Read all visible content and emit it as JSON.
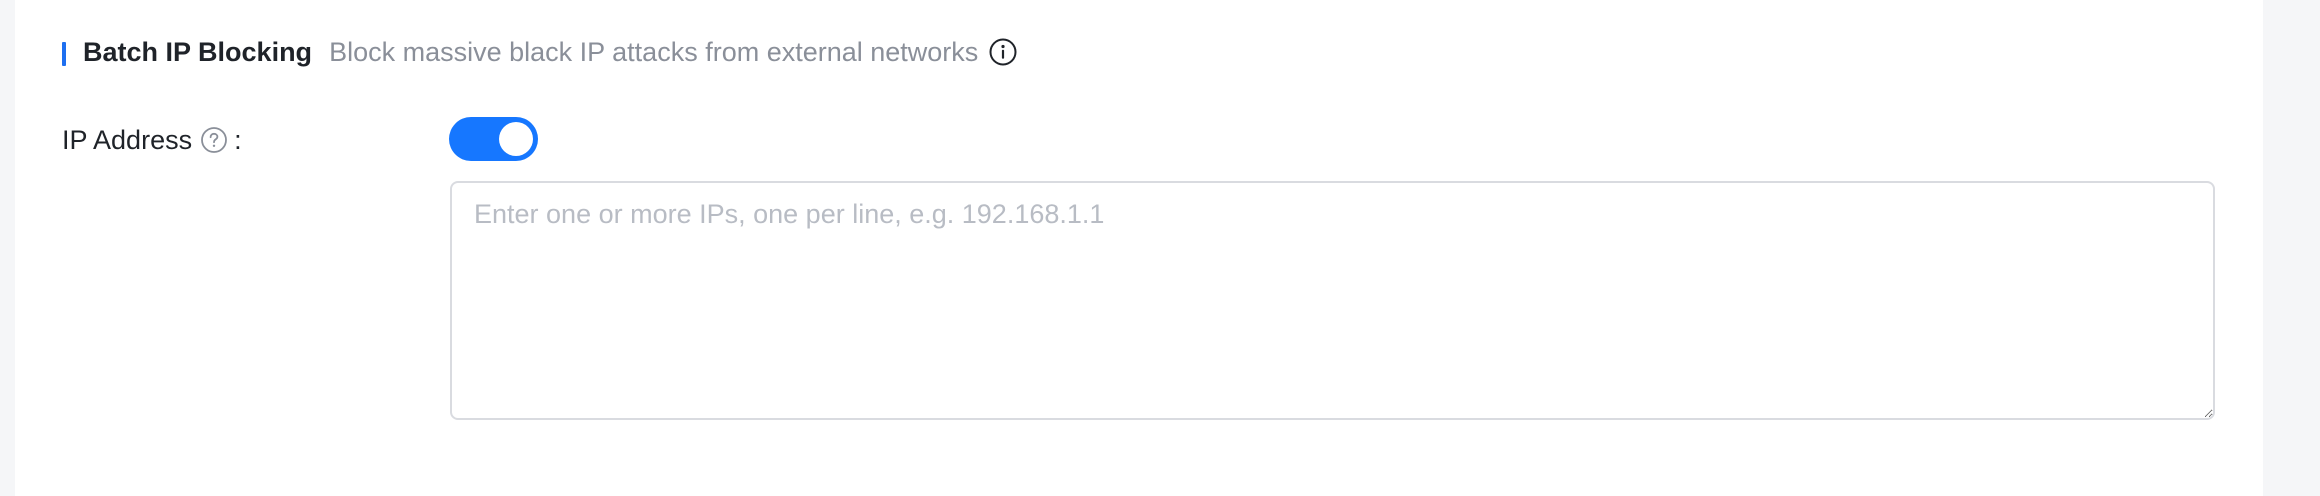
{
  "section": {
    "title": "Batch IP Blocking",
    "description": "Block massive black IP attacks from external networks",
    "info_icon": "info-circle-icon",
    "accent_color": "#1e6ff0"
  },
  "form": {
    "ip_address": {
      "label": "IP Address",
      "help_icon": "question-circle-icon",
      "colon": ":",
      "toggle_enabled": true,
      "toggle_color": "#1677ff",
      "textarea_value": "",
      "textarea_placeholder": "Enter one or more IPs, one per line, e.g. 192.168.1.1"
    }
  }
}
